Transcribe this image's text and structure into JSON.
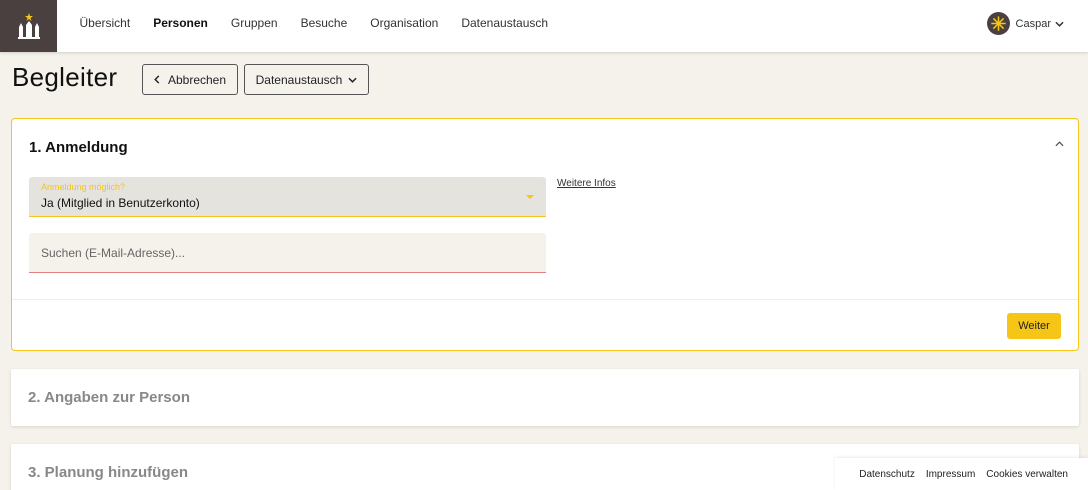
{
  "nav": {
    "items": [
      "Übersicht",
      "Personen",
      "Gruppen",
      "Besuche",
      "Organisation",
      "Datenaustausch"
    ],
    "active_index": 1
  },
  "user": {
    "name": "Caspar",
    "icon": "chevron-down-icon"
  },
  "header": {
    "title": "Begleiter",
    "cancel_label": "Abbrechen",
    "export_label": "Datenaustausch"
  },
  "step1": {
    "title": "1. Anmeldung",
    "select_label": "Anmeldung möglich?",
    "select_value": "Ja (Mitglied in Benutzerkonto)",
    "info_link": "Weitere Infos",
    "search_placeholder": "Suchen (E-Mail-Adresse)...",
    "next_label": "Weiter"
  },
  "step2": {
    "title": "2. Angaben zur Person"
  },
  "step3": {
    "title": "3. Planung hinzufügen"
  },
  "footer": {
    "links": [
      "Datenschutz",
      "Impressum",
      "Cookies verwalten"
    ]
  },
  "colors": {
    "accent": "#f5c518",
    "brand": "#4a4040",
    "background": "#f4f2ea"
  }
}
